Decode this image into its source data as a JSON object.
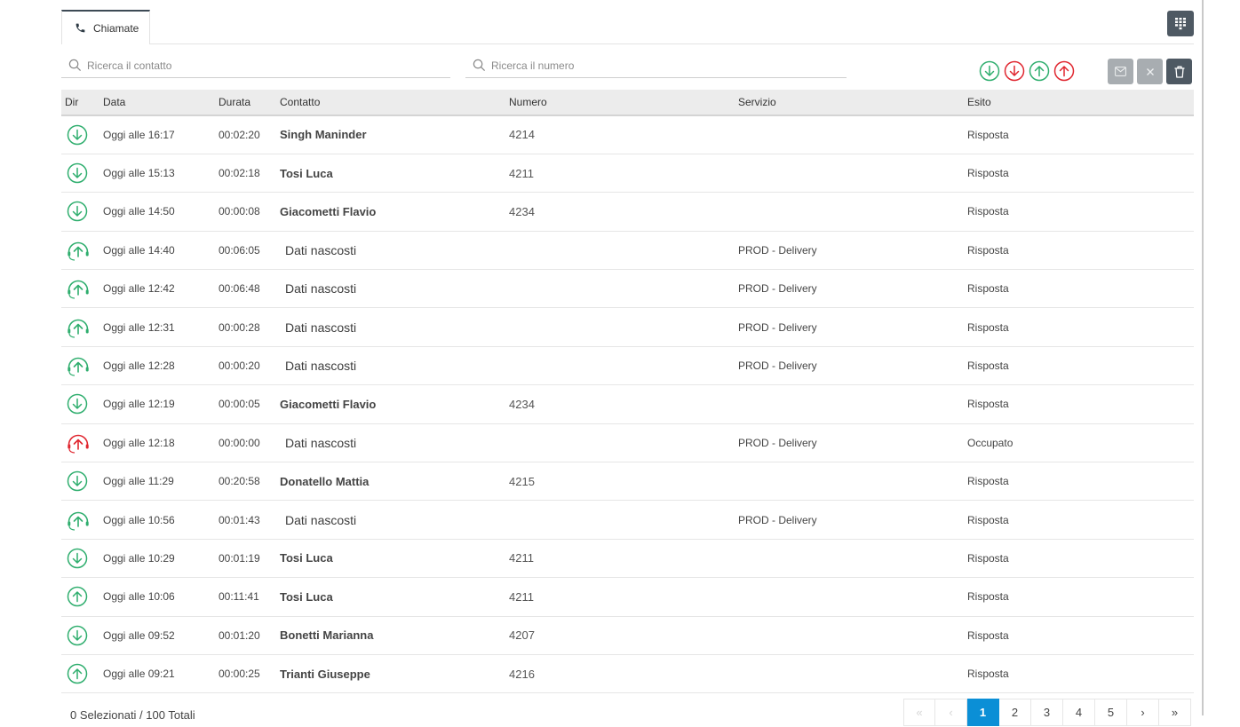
{
  "tabs": [
    {
      "label": "Chiamate",
      "icon": "phone-icon"
    }
  ],
  "toolbar": {
    "dialpad_icon": "dialpad-icon",
    "contact_search_placeholder": "Ricerca il contatto",
    "number_search_placeholder": "Ricerca il numero",
    "filters": [
      {
        "icon": "incoming-answered-icon",
        "color": "#2fae6e"
      },
      {
        "icon": "incoming-missed-icon",
        "color": "#e0262f"
      },
      {
        "icon": "outgoing-answered-icon",
        "color": "#2fae6e"
      },
      {
        "icon": "outgoing-missed-icon",
        "color": "#e0262f"
      }
    ],
    "actions": [
      "mail-icon",
      "close-icon",
      "trash-icon"
    ]
  },
  "table": {
    "columns": [
      "Dir",
      "Data",
      "Durata",
      "Contatto",
      "Numero",
      "Servizio",
      "Esito"
    ],
    "rows": [
      {
        "dir": "in",
        "data": "Oggi alle 16:17",
        "durata": "00:02:20",
        "contatto": "Singh Maninder",
        "hidden": false,
        "numero": "4214",
        "servizio": "",
        "esito": "Risposta"
      },
      {
        "dir": "in",
        "data": "Oggi alle 15:13",
        "durata": "00:02:18",
        "contatto": "Tosi Luca",
        "hidden": false,
        "numero": "4211",
        "servizio": "",
        "esito": "Risposta"
      },
      {
        "dir": "in",
        "data": "Oggi alle 14:50",
        "durata": "00:00:08",
        "contatto": "Giacometti Flavio",
        "hidden": false,
        "numero": "4234",
        "servizio": "",
        "esito": "Risposta"
      },
      {
        "dir": "out-headset",
        "data": "Oggi alle 14:40",
        "durata": "00:06:05",
        "contatto": "Dati nascosti",
        "hidden": true,
        "numero": "",
        "servizio": "PROD - Delivery",
        "esito": "Risposta"
      },
      {
        "dir": "out-headset",
        "data": "Oggi alle 12:42",
        "durata": "00:06:48",
        "contatto": "Dati nascosti",
        "hidden": true,
        "numero": "",
        "servizio": "PROD - Delivery",
        "esito": "Risposta"
      },
      {
        "dir": "out-headset",
        "data": "Oggi alle 12:31",
        "durata": "00:00:28",
        "contatto": "Dati nascosti",
        "hidden": true,
        "numero": "",
        "servizio": "PROD - Delivery",
        "esito": "Risposta"
      },
      {
        "dir": "out-headset",
        "data": "Oggi alle 12:28",
        "durata": "00:00:20",
        "contatto": "Dati nascosti",
        "hidden": true,
        "numero": "",
        "servizio": "PROD - Delivery",
        "esito": "Risposta"
      },
      {
        "dir": "in",
        "data": "Oggi alle 12:19",
        "durata": "00:00:05",
        "contatto": "Giacometti Flavio",
        "hidden": false,
        "numero": "4234",
        "servizio": "",
        "esito": "Risposta"
      },
      {
        "dir": "out-headset-missed",
        "data": "Oggi alle 12:18",
        "durata": "00:00:00",
        "contatto": "Dati nascosti",
        "hidden": true,
        "numero": "",
        "servizio": "PROD - Delivery",
        "esito": "Occupato"
      },
      {
        "dir": "in",
        "data": "Oggi alle 11:29",
        "durata": "00:20:58",
        "contatto": "Donatello Mattia",
        "hidden": false,
        "numero": "4215",
        "servizio": "",
        "esito": "Risposta"
      },
      {
        "dir": "out-headset",
        "data": "Oggi alle 10:56",
        "durata": "00:01:43",
        "contatto": "Dati nascosti",
        "hidden": true,
        "numero": "",
        "servizio": "PROD - Delivery",
        "esito": "Risposta"
      },
      {
        "dir": "in",
        "data": "Oggi alle 10:29",
        "durata": "00:01:19",
        "contatto": "Tosi Luca",
        "hidden": false,
        "numero": "4211",
        "servizio": "",
        "esito": "Risposta"
      },
      {
        "dir": "out",
        "data": "Oggi alle 10:06",
        "durata": "00:11:41",
        "contatto": "Tosi Luca",
        "hidden": false,
        "numero": "4211",
        "servizio": "",
        "esito": "Risposta"
      },
      {
        "dir": "in",
        "data": "Oggi alle 09:52",
        "durata": "00:01:20",
        "contatto": "Bonetti Marianna",
        "hidden": false,
        "numero": "4207",
        "servizio": "",
        "esito": "Risposta"
      },
      {
        "dir": "out",
        "data": "Oggi alle 09:21",
        "durata": "00:00:25",
        "contatto": "Trianti Giuseppe",
        "hidden": false,
        "numero": "4216",
        "servizio": "",
        "esito": "Risposta"
      }
    ]
  },
  "footer": {
    "selection_text": "0 Selezionati / 100 Totali"
  },
  "pagination": {
    "pages": [
      "1",
      "2",
      "3",
      "4",
      "5"
    ],
    "current": "1",
    "first_label": "«",
    "prev_label": "‹",
    "next_label": "›",
    "last_label": "»"
  },
  "colors": {
    "ok": "#2fae6e",
    "ko": "#e0262f",
    "active_page": "#0b8fd6",
    "button_dark": "#4e5963"
  }
}
